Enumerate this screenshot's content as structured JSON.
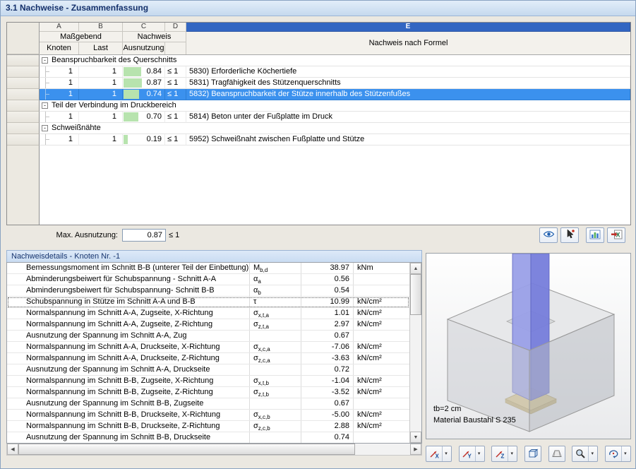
{
  "title_bar": {
    "title": "3.1 Nachweise - Zusammenfassung"
  },
  "results_table": {
    "column_letters": [
      "A",
      "B",
      "C",
      "D",
      "E"
    ],
    "headers": {
      "massgebend": "Maßgebend",
      "nachweis": "Nachweis",
      "knoten": "Knoten",
      "last": "Last",
      "ausnutzung": "Ausnutzung",
      "formel": "Nachweis nach Formel"
    },
    "collapse_glyph": "-",
    "rows": [
      {
        "type": "group",
        "label": "Beanspruchbarkeit des Querschnitts"
      },
      {
        "type": "data",
        "knoten": "1",
        "last": "1",
        "ausnutzung": "0.84",
        "limit": "≤ 1",
        "formel": "5830) Erforderliche Köchertiefe"
      },
      {
        "type": "data",
        "knoten": "1",
        "last": "1",
        "ausnutzung": "0.87",
        "limit": "≤ 1",
        "formel": "5831) Tragfähigkeit des Stützenquerschnitts"
      },
      {
        "type": "data",
        "selected": true,
        "knoten": "1",
        "last": "1",
        "ausnutzung": "0.74",
        "limit": "≤ 1",
        "formel": "5832) Beanspruchbarkeit der Stütze innerhalb des Stützenfußes"
      },
      {
        "type": "group",
        "label": "Teil der Verbindung im Druckbereich"
      },
      {
        "type": "data",
        "knoten": "1",
        "last": "1",
        "ausnutzung": "0.70",
        "limit": "≤ 1",
        "formel": "5814) Beton unter der Fußplatte im Druck"
      },
      {
        "type": "group",
        "label": "Schweißnähte"
      },
      {
        "type": "data",
        "knoten": "1",
        "last": "1",
        "ausnutzung": "0.19",
        "limit": "≤ 1",
        "formel": "5952) Schweißnaht zwischen Fußplatte und Stütze"
      }
    ],
    "footer": {
      "max_label": "Max. Ausnutzung:",
      "max_value": "0.87",
      "max_limit": "≤ 1"
    }
  },
  "result_toolbar": {
    "buttons": [
      {
        "icon": "eye-icon",
        "name": "visibility-button"
      },
      {
        "icon": "pick-arrow-icon",
        "name": "pick-object-button"
      },
      {
        "icon": "result-diagram-icon",
        "name": "result-diagram-button"
      },
      {
        "icon": "excel-export-icon",
        "name": "excel-export-button"
      }
    ]
  },
  "details_panel": {
    "title": "Nachweisdetails - Knoten Nr. -1",
    "rows": [
      {
        "desc": "Bemessungsmoment im Schnitt B-B (unterer Teil der Einbettung)",
        "sym": "M",
        "sub": "b,d",
        "value": "38.97",
        "unit": "kNm"
      },
      {
        "desc": "Abminderungsbeiwert für Schubspannung - Schnitt A-A",
        "sym": "α",
        "sub": "a",
        "value": "0.56",
        "unit": ""
      },
      {
        "desc": "Abminderungsbeiwert für Schubspannung- Schnitt B-B",
        "sym": "α",
        "sub": "b",
        "value": "0.54",
        "unit": ""
      },
      {
        "desc": "Schubspannung in Stütze im Schnitt A-A und B-B",
        "sym": "τ",
        "sub": "",
        "value": "10.99",
        "unit": "kN/cm²",
        "focused": true
      },
      {
        "desc": "Normalspannung im Schnitt A-A, Zugseite, X-Richtung",
        "sym": "σ",
        "sub": "x,t,a",
        "value": "1.01",
        "unit": "kN/cm²"
      },
      {
        "desc": "Normalspannung im Schnitt A-A, Zugseite, Z-Richtung",
        "sym": "σ",
        "sub": "z,t,a",
        "value": "2.97",
        "unit": "kN/cm²"
      },
      {
        "desc": "Ausnutzung der Spannung im Schnitt A-A, Zug",
        "sym": "",
        "sub": "",
        "value": "0.67",
        "unit": ""
      },
      {
        "desc": "Normalspannung im Schnitt A-A, Druckseite, X-Richtung",
        "sym": "σ",
        "sub": "x,c,a",
        "value": "-7.06",
        "unit": "kN/cm²"
      },
      {
        "desc": "Normalspannung im Schnitt A-A, Druckseite, Z-Richtung",
        "sym": "σ",
        "sub": "z,c,a",
        "value": "-3.63",
        "unit": "kN/cm²"
      },
      {
        "desc": "Ausnutzung der Spannung im Schnitt A-A, Druckseite",
        "sym": "",
        "sub": "",
        "value": "0.72",
        "unit": ""
      },
      {
        "desc": "Normalspannung im Schnitt B-B, Zugseite, X-Richtung",
        "sym": "σ",
        "sub": "x,t,b",
        "value": "-1.04",
        "unit": "kN/cm²"
      },
      {
        "desc": "Normalspannung im Schnitt B-B, Zugseite, Z-Richtung",
        "sym": "σ",
        "sub": "z,t,b",
        "value": "-3.52",
        "unit": "kN/cm²"
      },
      {
        "desc": "Ausnutzung der Spannung im Schnitt B-B, Zugseite",
        "sym": "",
        "sub": "",
        "value": "0.67",
        "unit": ""
      },
      {
        "desc": "Normalspannung im Schnitt B-B, Druckseite, X-Richtung",
        "sym": "σ",
        "sub": "x,c,b",
        "value": "-5.00",
        "unit": "kN/cm²"
      },
      {
        "desc": "Normalspannung im Schnitt B-B, Druckseite, Z-Richtung",
        "sym": "σ",
        "sub": "z,c,b",
        "value": "2.88",
        "unit": "kN/cm²"
      },
      {
        "desc": "Ausnutzung der Spannung im Schnitt B-B, Druckseite",
        "sym": "",
        "sub": "",
        "value": "0.74",
        "unit": ""
      }
    ]
  },
  "viewer": {
    "annotations": [
      "tb=2 cm",
      "Material Baustahl S 235"
    ],
    "toolbar": {
      "axis_labels": [
        "X",
        "Y",
        "Z"
      ],
      "buttons": [
        {
          "icon": "view-x-axis-icon",
          "name": "view-x-button",
          "dropdown": true
        },
        {
          "icon": "view-y-axis-icon",
          "name": "view-y-button",
          "dropdown": true
        },
        {
          "icon": "view-z-axis-icon",
          "name": "view-z-button",
          "dropdown": true
        },
        {
          "icon": "isometric-cube-icon",
          "name": "isometric-view-button",
          "dropdown": false
        },
        {
          "icon": "perspective-icon",
          "name": "perspective-view-button",
          "dropdown": false
        },
        {
          "icon": "magnifier-icon",
          "name": "zoom-button",
          "dropdown": true
        },
        {
          "icon": "rotate-icon",
          "name": "rotate-view-button",
          "dropdown": true
        }
      ]
    },
    "colors": {
      "column": "#8a90e2",
      "block": "#d9dadd",
      "plate": "#dcc98e",
      "selection": "#3b91ee",
      "bar": "#b7e3ae"
    }
  }
}
